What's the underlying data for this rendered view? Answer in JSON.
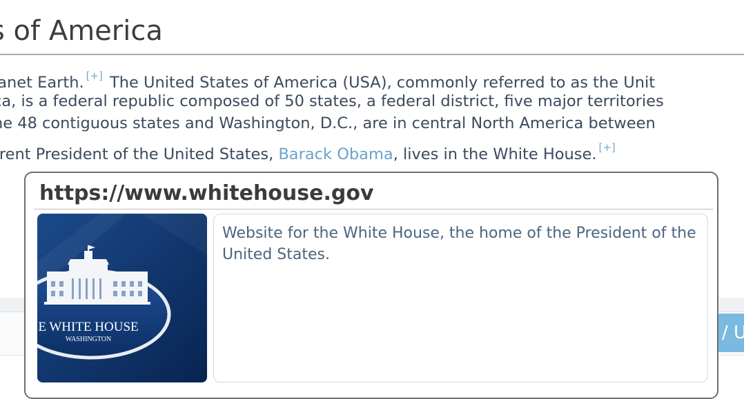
{
  "article": {
    "title": "s of America",
    "lines": [
      {
        "a": "lanet Earth.",
        "cite": "[+]",
        "b": " The United States of America (USA), commonly referred to as the Unit"
      },
      {
        "a": "ca, is a federal republic composed of 50 states, a federal district, five major territories"
      },
      {
        "a": "he 48 contiguous states and Washington, D.C., are in central North America between"
      },
      {
        "a": "rrent President of the United States, ",
        "link": "Barack Obama",
        "b": ", lives in the White House.",
        "cite": "[+]"
      }
    ]
  },
  "background": {
    "button_label": "/ U"
  },
  "popover": {
    "url": "https://www.whitehouse.gov",
    "description": "Website for the White House, the home of the President of the United States.",
    "thumbnail": {
      "logo_line1": "E WHITE HOUSE",
      "logo_line2": "WASHINGTON"
    }
  },
  "colors": {
    "link": "#6aa3cc",
    "thumbnail_bg": "#0d3266",
    "accent_button": "#7ab9e0"
  }
}
